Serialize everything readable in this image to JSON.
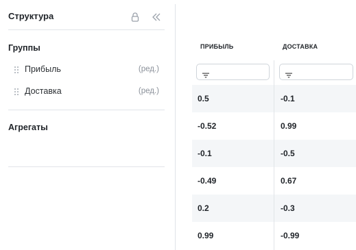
{
  "panel": {
    "title": "Структура",
    "groups_title": "Группы",
    "groups": [
      {
        "label": "Прибыль",
        "edit": "(ред.)"
      },
      {
        "label": "Доставка",
        "edit": "(ред.)"
      }
    ],
    "aggregates_title": "Агрегаты"
  },
  "table": {
    "columns": [
      "ПРИБЫЛЬ",
      "ДОСТАВКА"
    ],
    "rows": [
      [
        "0.5",
        "-0.1"
      ],
      [
        "-0.52",
        "0.99"
      ],
      [
        "-0.1",
        "-0.5"
      ],
      [
        "-0.49",
        "0.67"
      ],
      [
        "0.2",
        "-0.3"
      ],
      [
        "0.99",
        "-0.99"
      ]
    ]
  },
  "icons": {
    "lock": "lock-icon",
    "collapse": "double-chevron-left-icon",
    "grip": "drag-handle-icon",
    "filter": "filter-icon"
  },
  "colors": {
    "row_alt": "#f4f6f8",
    "divider": "#e1e4e8",
    "muted": "#8a9099"
  }
}
